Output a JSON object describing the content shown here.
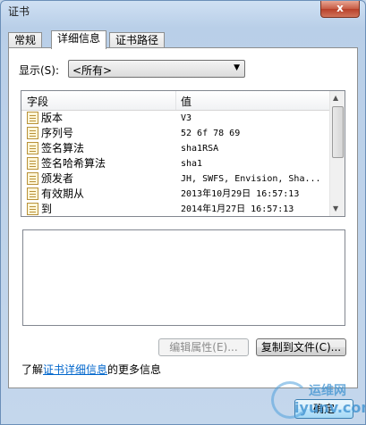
{
  "window": {
    "title": "证书",
    "close_label": "x"
  },
  "tabs": [
    {
      "label": "常规"
    },
    {
      "label": "详细信息"
    },
    {
      "label": "证书路径"
    }
  ],
  "show": {
    "label": "显示(S):",
    "selected": "<所有>"
  },
  "list": {
    "columns": [
      "字段",
      "值"
    ],
    "rows": [
      {
        "field": "版本",
        "value": "V3"
      },
      {
        "field": "序列号",
        "value": "52 6f 78 69"
      },
      {
        "field": "签名算法",
        "value": "sha1RSA"
      },
      {
        "field": "签名哈希算法",
        "value": "sha1"
      },
      {
        "field": "颁发者",
        "value": "JH, SWFS, Envision, Sha..."
      },
      {
        "field": "有效期从",
        "value": "2013年10月29日 16:57:13"
      },
      {
        "field": "到",
        "value": "2014年1月27日 16:57:13"
      }
    ]
  },
  "buttons": {
    "edit_properties": "编辑属性(E)...",
    "copy_to_file": "复制到文件(C)...",
    "ok": "确定"
  },
  "learn_more": {
    "prefix": "了解",
    "link": "证书详细信息",
    "suffix": "的更多信息"
  },
  "watermark": {
    "top": "运维网",
    "bottom": "iyunv.com"
  },
  "icons": {
    "close": "close-icon",
    "dropdown": "chevron-down-icon",
    "field": "certificate-field-icon",
    "scroll_up": "scroll-up-arrow-icon",
    "scroll_down": "scroll-down-arrow-icon"
  }
}
